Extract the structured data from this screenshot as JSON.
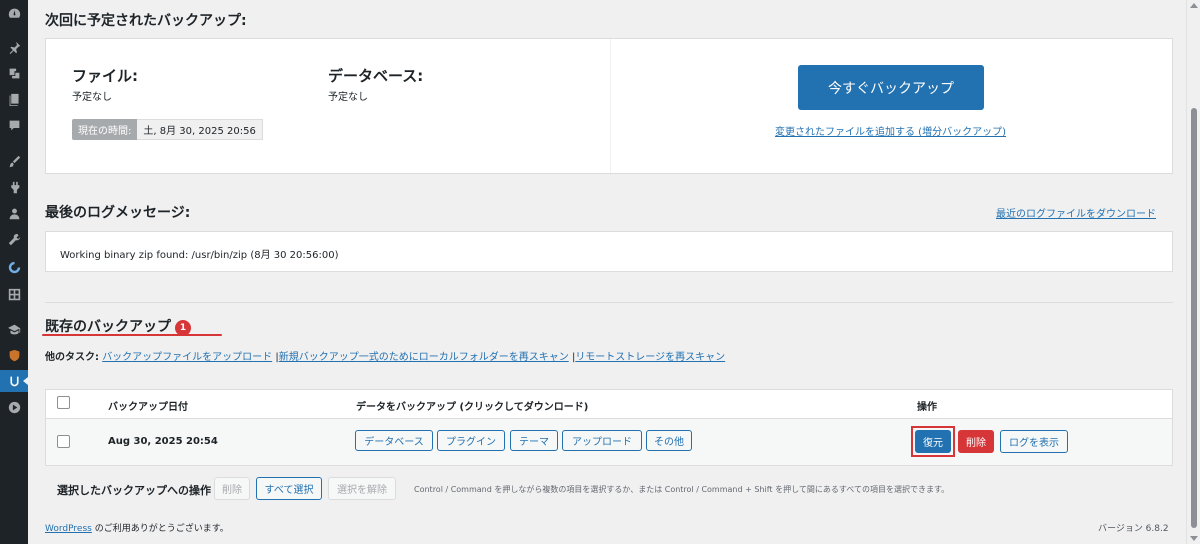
{
  "next_backups": {
    "title": "次回に予定されたバックアップ:",
    "files_label": "ファイル:",
    "files_value": "予定なし",
    "db_label": "データベース:",
    "db_value": "予定なし",
    "time_label": "現在の時間:",
    "time_value": "土, 8月 30, 2025 20:56",
    "backup_now": "今すぐバックアップ",
    "incremental_link": "変更されたファイルを追加する (増分バックアップ)"
  },
  "log": {
    "title": "最後のログメッセージ:",
    "download_link": "最近のログファイルをダウンロード",
    "message": "Working binary zip found: /usr/bin/zip (8月 30 20:56:00)"
  },
  "existing": {
    "title": "既存のバックアップ",
    "count": "1",
    "other_tasks_label": "他のタスク:",
    "task_upload": "バックアップファイルをアップロード",
    "task_rescan_local": "新規バックアップ一式のためにローカルフォルダーを再スキャン",
    "task_rescan_remote": "リモートストレージを再スキャン",
    "sep": "|"
  },
  "table": {
    "col_date": "バックアップ日付",
    "col_data": "データをバックアップ (クリックしてダウンロード)",
    "col_actions": "操作",
    "row": {
      "date": "Aug 30, 2025 20:54",
      "data_buttons": [
        "データベース",
        "プラグイン",
        "テーマ",
        "アップロード",
        "その他"
      ],
      "restore": "復元",
      "delete": "削除",
      "view_log": "ログを表示"
    }
  },
  "bulk": {
    "label": "選択したバックアップへの操作",
    "delete": "削除",
    "select_all": "すべて選択",
    "deselect": "選択を解除",
    "hint": "Control / Command を押しながら複数の項目を選択するか、または Control / Command + Shift を押して間にあるすべての項目を選択できます。"
  },
  "footer": {
    "wp_link": "WordPress",
    "thanks": " のご利用ありがとうございます。",
    "version": "バージョン 6.8.2"
  },
  "colors": {
    "primary": "#2271b1",
    "danger": "#d63638",
    "sidebar": "#1d2327"
  }
}
